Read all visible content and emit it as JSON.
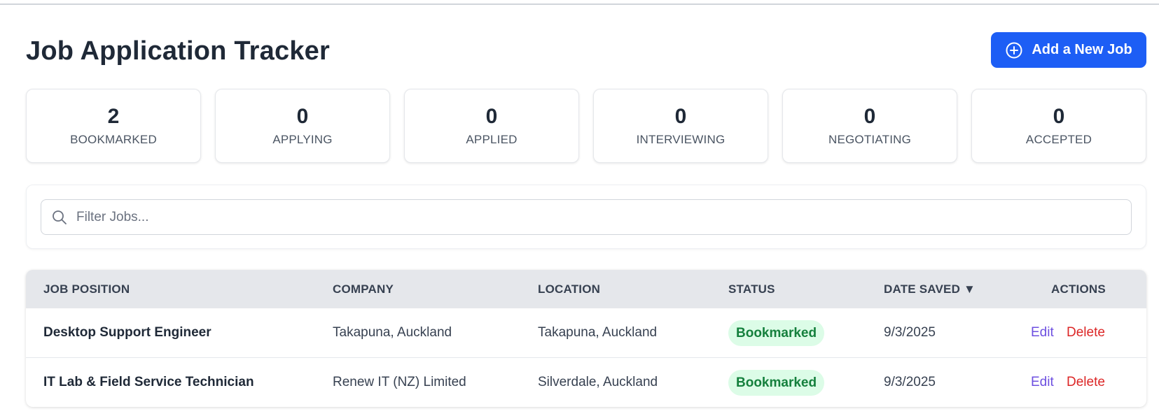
{
  "header": {
    "title": "Job Application Tracker",
    "add_button_label": "Add a New Job"
  },
  "stats": [
    {
      "value": "2",
      "label": "BOOKMARKED"
    },
    {
      "value": "0",
      "label": "APPLYING"
    },
    {
      "value": "0",
      "label": "APPLIED"
    },
    {
      "value": "0",
      "label": "INTERVIEWING"
    },
    {
      "value": "0",
      "label": "NEGOTIATING"
    },
    {
      "value": "0",
      "label": "ACCEPTED"
    }
  ],
  "filter": {
    "placeholder": "Filter Jobs...",
    "value": ""
  },
  "table": {
    "columns": {
      "position": "JOB POSITION",
      "company": "COMPANY",
      "location": "LOCATION",
      "status": "STATUS",
      "date_saved": "DATE SAVED ▼",
      "actions": "ACTIONS"
    },
    "rows": [
      {
        "position": "Desktop Support Engineer",
        "company": "Takapuna, Auckland",
        "location": "Takapuna, Auckland",
        "status": "Bookmarked",
        "date_saved": "9/3/2025",
        "edit_label": "Edit",
        "delete_label": "Delete"
      },
      {
        "position": "IT Lab & Field Service Technician",
        "company": "Renew IT (NZ) Limited",
        "location": "Silverdale, Auckland",
        "status": "Bookmarked",
        "date_saved": "9/3/2025",
        "edit_label": "Edit",
        "delete_label": "Delete"
      }
    ]
  },
  "icons": {
    "add": "plus-circle-icon",
    "filter": "search-icon"
  },
  "colors": {
    "primary": "#1d5ef5",
    "badge_bg": "#dcfce7",
    "badge_text": "#15803d",
    "edit": "#6d4fe0",
    "delete": "#dc2626"
  }
}
